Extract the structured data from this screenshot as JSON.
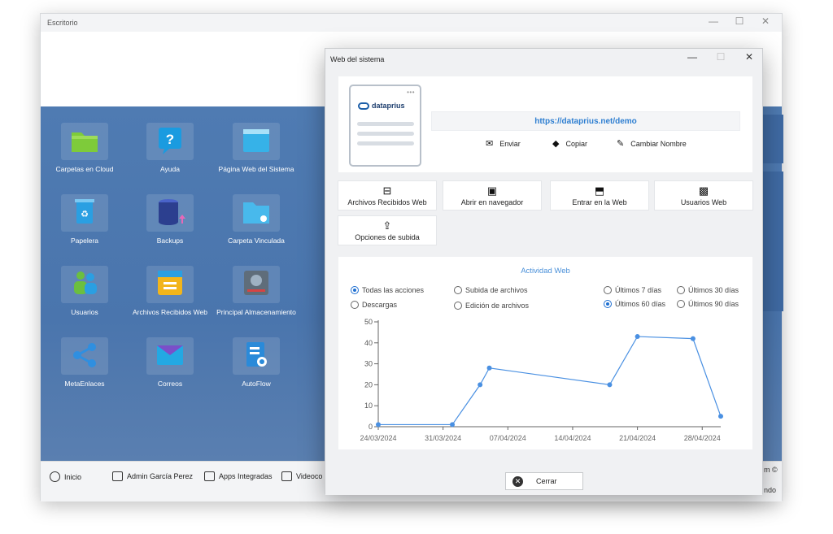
{
  "main_window": {
    "title": "Escritorio",
    "controls": {
      "minimize": "—",
      "maximize": "☐",
      "close": "✕"
    }
  },
  "desktop": {
    "tiles": [
      {
        "label": "Carpetas en Cloud",
        "icon": "folder-icon",
        "color": "#7ecb3a"
      },
      {
        "label": "Ayuda",
        "icon": "help-icon",
        "color": "#1a9be0"
      },
      {
        "label": "Página Web del Sistema",
        "icon": "web-page-icon",
        "color": "#36b2e8"
      },
      {
        "label": "Papelera",
        "icon": "recycle-bin-icon",
        "color": "#2a9fe2"
      },
      {
        "label": "Backups",
        "icon": "database-backup-icon",
        "color": "#2c3f8f"
      },
      {
        "label": "Carpeta Vinculada",
        "icon": "linked-folder-icon",
        "color": "#48b9ec"
      },
      {
        "label": "Usuarios",
        "icon": "users-icon",
        "color": "#6bbf3f"
      },
      {
        "label": "Archivos Recibidos Web",
        "icon": "received-files-icon",
        "color": "#f2b51b"
      },
      {
        "label": "Principal Almacenamiento",
        "icon": "storage-icon",
        "color": "#5f6d7a"
      },
      {
        "label": "MetaEnlaces",
        "icon": "share-nodes-icon",
        "color": "#2f8fe0"
      },
      {
        "label": "Correos",
        "icon": "mail-icon",
        "color": "#23a8e3"
      },
      {
        "label": "AutoFlow",
        "icon": "autoflow-icon",
        "color": "#2a8ad9"
      }
    ]
  },
  "taskbar": {
    "items": [
      {
        "label": "Inicio",
        "icon": "chevron-up-circle-icon"
      },
      {
        "label": "Admin García Perez",
        "icon": "user-badge-icon"
      },
      {
        "label": "Apps Integradas",
        "icon": "apps-window-icon"
      },
      {
        "label": "Videoco",
        "icon": "video-camera-icon"
      }
    ],
    "corner_top": "m ©",
    "corner_bottom": "ndo"
  },
  "dialog": {
    "title": "Web del sistema",
    "controls": {
      "minimize": "—",
      "maximize": "☐",
      "close": "✕"
    },
    "brand": "dataprius",
    "url": "https://dataprius.net/demo",
    "link_actions": [
      {
        "label": "Enviar",
        "icon": "envelope-icon",
        "glyph": "✉"
      },
      {
        "label": "Copiar",
        "icon": "copy-layers-icon",
        "glyph": "◆"
      },
      {
        "label": "Cambiar Nombre",
        "icon": "edit-icon",
        "glyph": "✎"
      }
    ],
    "buttons": [
      {
        "label": "Archivos Recibidos Web",
        "icon": "inbox-icon",
        "glyph": "⊟"
      },
      {
        "label": "Abrir en navegador",
        "icon": "browser-icon",
        "glyph": "▣"
      },
      {
        "label": "Entrar en la Web",
        "icon": "enter-web-icon",
        "glyph": "⬒"
      },
      {
        "label": "Usuarios Web",
        "icon": "user-portrait-icon",
        "glyph": "▩"
      },
      {
        "label": "Opciones de subida",
        "icon": "upload-options-icon",
        "glyph": "⇪"
      }
    ],
    "close_label": "Cerrar"
  },
  "activity": {
    "filters_actions": [
      {
        "label": "Todas las acciones",
        "selected": true
      },
      {
        "label": "Subida de archivos",
        "selected": false
      },
      {
        "label": "Descargas",
        "selected": false
      },
      {
        "label": "Edición de archivos",
        "selected": false
      }
    ],
    "filters_period": [
      {
        "label": "Últimos 7 días",
        "selected": false
      },
      {
        "label": "Últimos 30 días",
        "selected": false
      },
      {
        "label": "Últimos 60 días",
        "selected": true
      },
      {
        "label": "Últimos 90 días",
        "selected": false
      }
    ]
  },
  "chart_data": {
    "type": "line",
    "title": "Actividad Web",
    "x_tick_labels": [
      "24/03/2024",
      "31/03/2024",
      "07/04/2024",
      "14/04/2024",
      "21/04/2024",
      "28/04/2024"
    ],
    "x_range": [
      "2024-03-24",
      "2024-04-30"
    ],
    "y_ticks": [
      0,
      10,
      20,
      30,
      40,
      50
    ],
    "ylim": [
      0,
      50
    ],
    "grid": false,
    "series": [
      {
        "color": "#4a90e2",
        "points": [
          {
            "x": "2024-03-24",
            "y": 1
          },
          {
            "x": "2024-04-01",
            "y": 1
          },
          {
            "x": "2024-04-04",
            "y": 20
          },
          {
            "x": "2024-04-05",
            "y": 28
          },
          {
            "x": "2024-04-18",
            "y": 20
          },
          {
            "x": "2024-04-21",
            "y": 43
          },
          {
            "x": "2024-04-27",
            "y": 42
          },
          {
            "x": "2024-04-30",
            "y": 5
          }
        ]
      }
    ]
  }
}
